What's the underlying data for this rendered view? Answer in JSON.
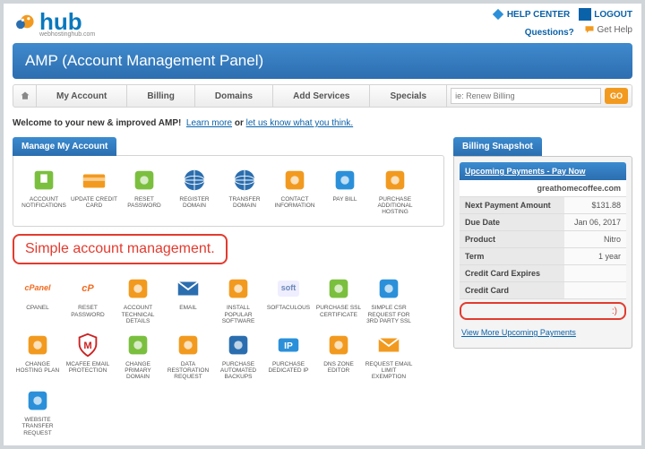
{
  "branding": {
    "name": "hub",
    "tagline": "webhostinghub.com"
  },
  "toplinks": {
    "help": "HELP CENTER",
    "logout": "LOGOUT",
    "questions": "Questions?",
    "gethelp": "Get Help"
  },
  "page_title": "AMP (Account Management Panel)",
  "nav": {
    "tabs": [
      "My Account",
      "Billing",
      "Domains",
      "Add Services",
      "Specials"
    ],
    "search_placeholder": "ie: Renew Billing",
    "go": "GO"
  },
  "welcome": {
    "prefix": "Welcome to your new & improved AMP!",
    "learn": "Learn more",
    "or": " or ",
    "tell": "let us know what you think."
  },
  "manage": {
    "title": "Manage My Account",
    "tiles": [
      {
        "label": "ACCOUNT NOTIFICATIONS",
        "icon": "notify"
      },
      {
        "label": "UPDATE CREDIT CARD",
        "icon": "card"
      },
      {
        "label": "RESET PASSWORD",
        "icon": "calendar"
      },
      {
        "label": "REGISTER DOMAIN",
        "icon": "globe"
      },
      {
        "label": "TRANSFER DOMAIN",
        "icon": "globe-arrow"
      },
      {
        "label": "CONTACT INFORMATION",
        "icon": "contact"
      },
      {
        "label": "PAY BILL",
        "icon": "paybill"
      },
      {
        "label": "PURCHASE ADDITIONAL HOSTING",
        "icon": "cart"
      }
    ]
  },
  "callout": "Simple account management.",
  "grid2": [
    {
      "label": "CPANEL",
      "icon": "cpanel"
    },
    {
      "label": "RESET PASSWORD",
      "icon": "cp"
    },
    {
      "label": "ACCOUNT TECHNICAL DETAILS",
      "icon": "techdetails"
    },
    {
      "label": "EMAIL",
      "icon": "email"
    },
    {
      "label": "INSTALL POPULAR SOFTWARE",
      "icon": "install"
    },
    {
      "label": "SOFTACULOUS",
      "icon": "soft"
    },
    {
      "label": "PURCHASE SSL CERTIFICATE",
      "icon": "ssl"
    },
    {
      "label": "SIMPLE CSR REQUEST FOR 3RD PARTY SSL",
      "icon": "csr"
    },
    {
      "label": "CHANGE HOSTING PLAN",
      "icon": "hosting"
    },
    {
      "label": "MCAFEE EMAIL PROTECTION",
      "icon": "mcafee"
    },
    {
      "label": "CHANGE PRIMARY DOMAIN",
      "icon": "primary"
    },
    {
      "label": "DATA RESTORATION REQUEST",
      "icon": "restore"
    },
    {
      "label": "PURCHASE AUTOMATED BACKUPS",
      "icon": "backup"
    },
    {
      "label": "PURCHASE DEDICATED IP",
      "icon": "ip"
    },
    {
      "label": "DNS ZONE EDITOR",
      "icon": "dns"
    },
    {
      "label": "REQUEST EMAIL LIMIT EXEMPTION",
      "icon": "emaillimit"
    },
    {
      "label": "WEBSITE TRANSFER REQUEST",
      "icon": "transfer"
    }
  ],
  "billing": {
    "title": "Billing Snapshot",
    "upcoming": "Upcoming Payments - Pay Now",
    "domain": "greathomecoffee.com",
    "rows": [
      [
        "Next Payment Amount",
        "$131.88"
      ],
      [
        "Due Date",
        "Jan 06, 2017"
      ],
      [
        "Product",
        "Nitro"
      ],
      [
        "Term",
        "1 year"
      ],
      [
        "Credit Card Expires",
        ""
      ],
      [
        "Credit Card",
        ""
      ]
    ],
    "smiley": ":)",
    "viewmore": "View More Upcoming Payments"
  }
}
